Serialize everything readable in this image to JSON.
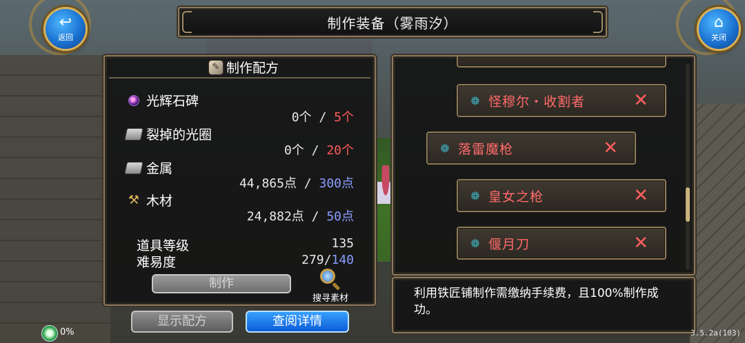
{
  "title": "制作装备（雾雨汐）",
  "buttons": {
    "back": {
      "glyph": "↩",
      "label": "返回"
    },
    "close": {
      "glyph": "⌂",
      "label": "关闭"
    }
  },
  "recipe": {
    "header": "制作配方",
    "materials": [
      {
        "name": "光辉石碑",
        "icon": "orb-icon",
        "have": "0个",
        "sep": " / ",
        "need": "5个",
        "need_color": "red"
      },
      {
        "name": "裂掉的光圈",
        "icon": "chest-icon",
        "have": "0个",
        "sep": " / ",
        "need": "20个",
        "need_color": "red"
      },
      {
        "name": "金属",
        "icon": "chest-icon",
        "have": "44,865点",
        "sep": " / ",
        "need": "300点",
        "need_color": "blue"
      },
      {
        "name": "木材",
        "icon": "wood-icon",
        "have": "24,882点",
        "sep": " / ",
        "need": "50点",
        "need_color": "blue"
      }
    ],
    "item_level_label": "道具等级",
    "item_level_value": "135",
    "difficulty_label": "难易度",
    "difficulty_have": "279/",
    "difficulty_need": "140",
    "make_button": "制作",
    "search_label": "搜寻素材"
  },
  "bottom": {
    "show_recipe": "显示配方",
    "view_details": "查阅详情"
  },
  "equipment_list": [
    {
      "name": "怪穆尔・收割者",
      "selected": false
    },
    {
      "name": "落雷魔枪",
      "selected": true
    },
    {
      "name": "皇女之枪",
      "selected": false
    },
    {
      "name": "偃月刀",
      "selected": false
    }
  ],
  "description": "利用铁匠铺制作需缴纳手续费，且100%制作成功。",
  "status": {
    "percent": "0%"
  },
  "version": "3.5.2a(103)",
  "colors": {
    "need_red": "#ff5a5a",
    "need_blue": "#8a9cff",
    "item_red": "#ff6a6a",
    "gold_border": "#8c7a5c"
  }
}
